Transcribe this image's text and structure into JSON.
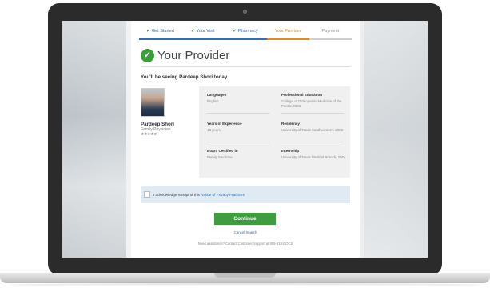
{
  "steps": [
    {
      "label": "Get Started",
      "state": "done"
    },
    {
      "label": "Your Visit",
      "state": "done"
    },
    {
      "label": "Pharmacy",
      "state": "done"
    },
    {
      "label": "Your Provider",
      "state": "active"
    },
    {
      "label": "Payment",
      "state": "pending"
    }
  ],
  "page": {
    "title": "Your Provider",
    "seeing_text": "You'll be seeing Pardeep Shori today."
  },
  "provider": {
    "name": "Pardeep Shori",
    "role": "Family Physician",
    "rating": "★★★★★"
  },
  "details": {
    "languages_label": "Languages",
    "languages_value": "English",
    "experience_label": "Years of Experience",
    "experience_value": "13 years",
    "board_label": "Board Certified in",
    "board_value": "Family Medicine",
    "education_label": "Professional Education",
    "education_value": "College of Osteopathic Medicine of the Pacific,2003",
    "residency_label": "Residency",
    "residency_value": "University of Texas Southwestern, 2006",
    "internship_label": "Internship",
    "internship_value": "University of Texas Medical Branch, 2004"
  },
  "ack": {
    "text_before": "I acknowledge receipt of this",
    "link_text": "Notice of Privacy Practices"
  },
  "actions": {
    "continue_label": "Continue",
    "cancel_label": "Cancel Search"
  },
  "footer": {
    "assistance_text": "Need assistance? Contact Customer Support at 855-818-DOCS"
  },
  "colors": {
    "primary_blue": "#2f6fb6",
    "active_orange": "#e58a17",
    "success_green": "#3e9e3e",
    "ack_background": "#dfeaf3"
  },
  "icons": {
    "title_check": "check-circle-icon",
    "step_check": "checkmark-icon"
  }
}
